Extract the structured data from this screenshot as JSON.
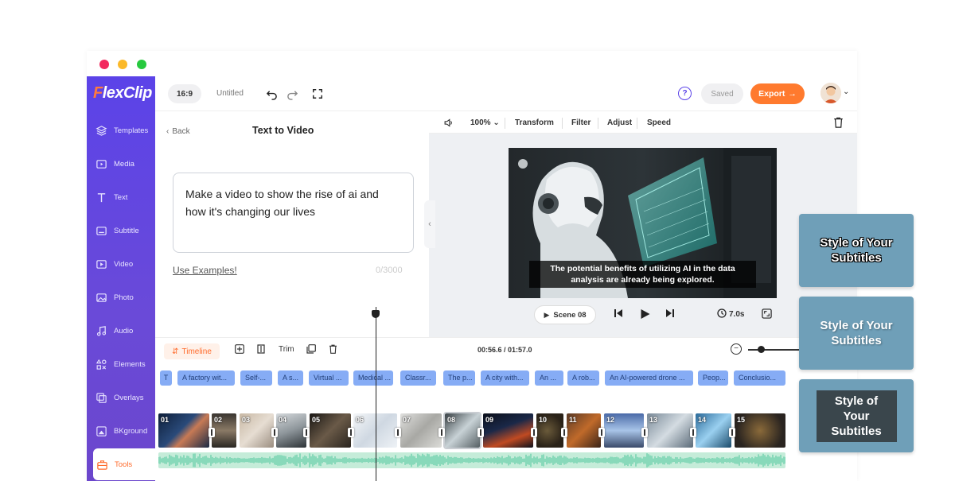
{
  "window": {
    "dot_colors": [
      "#f2285e",
      "#fbb929",
      "#27c93f"
    ]
  },
  "app": {
    "logo_first": "F",
    "logo_rest": "lexClip"
  },
  "sidebar": {
    "items": [
      {
        "label": "Templates",
        "icon": "layers-icon"
      },
      {
        "label": "Media",
        "icon": "media-icon"
      },
      {
        "label": "Text",
        "icon": "text-icon"
      },
      {
        "label": "Subtitle",
        "icon": "subtitle-icon"
      },
      {
        "label": "Video",
        "icon": "video-icon"
      },
      {
        "label": "Photo",
        "icon": "photo-icon"
      },
      {
        "label": "Audio",
        "icon": "audio-icon"
      },
      {
        "label": "Elements",
        "icon": "elements-icon"
      },
      {
        "label": "Overlays",
        "icon": "overlays-icon"
      },
      {
        "label": "BKground",
        "icon": "background-icon"
      },
      {
        "label": "Tools",
        "icon": "tools-icon",
        "active": true
      }
    ]
  },
  "topbar": {
    "ratio": "16:9",
    "title": "Untitled",
    "help": "?",
    "saved": "Saved",
    "export": "Export",
    "export_arrow": "→"
  },
  "panel": {
    "back": "Back",
    "title": "Text to Video",
    "prompt": "Make a video to show the rise of ai and how it's changing our lives",
    "examples": "Use Examples!",
    "counter": "0/3000"
  },
  "editor_bar": {
    "zoom": "100%",
    "items": [
      "Transform",
      "Filter",
      "Adjust",
      "Speed"
    ]
  },
  "preview": {
    "caption_line1": "The potential benefits of utilizing AI in the data",
    "caption_line2": "analysis are already being explored.",
    "scene": "Scene 08",
    "duration": "7.0s"
  },
  "timeline": {
    "tab": "Timeline",
    "trim": "Trim",
    "timecode": "00:56.6 / 01:57.0",
    "subtitles": [
      "T",
      "A factory wit...",
      "Self-...",
      "A s...",
      "Virtual ...",
      "Medical ...",
      "Classr...",
      "The p...",
      "A city with...",
      "An ...",
      "A rob...",
      "An AI-powered drone ...",
      "Peop...",
      "Conclusio..."
    ],
    "scenes": [
      "01",
      "02",
      "03",
      "04",
      "05",
      "06",
      "07",
      "08",
      "09",
      "10",
      "11",
      "12",
      "13",
      "14",
      "15"
    ]
  },
  "style_cards": [
    {
      "text": "Style of Your Subtitles"
    },
    {
      "text": "Style of Your Subtitles"
    },
    {
      "text": "Style of Your Subtitles"
    }
  ]
}
